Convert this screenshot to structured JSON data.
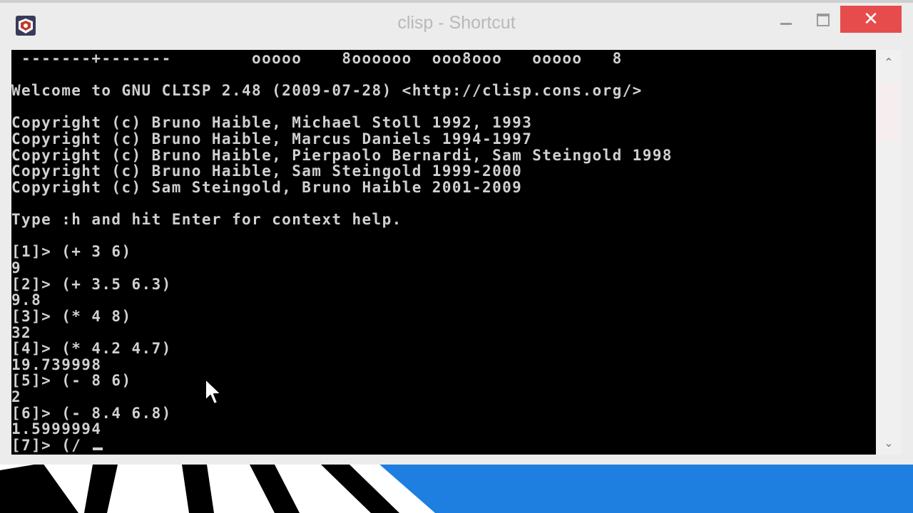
{
  "window": {
    "title": "clisp - Shortcut",
    "close_glyph": "✕"
  },
  "console": {
    "lines": [
      " -------+-------        ooooo    8oooooo  ooo8ooo   ooooo   8",
      "",
      "Welcome to GNU CLISP 2.48 (2009-07-28) <http://clisp.cons.org/>",
      "",
      "Copyright (c) Bruno Haible, Michael Stoll 1992, 1993",
      "Copyright (c) Bruno Haible, Marcus Daniels 1994-1997",
      "Copyright (c) Bruno Haible, Pierpaolo Bernardi, Sam Steingold 1998",
      "Copyright (c) Bruno Haible, Sam Steingold 1999-2000",
      "Copyright (c) Sam Steingold, Bruno Haible 2001-2009",
      "",
      "Type :h and hit Enter for context help.",
      "",
      "[1]> (+ 3 6)",
      "9",
      "[2]> (+ 3.5 6.3)",
      "9.8",
      "[3]> (* 4 8)",
      "32",
      "[4]> (* 4.2 4.7)",
      "19.739998",
      "[5]> (- 8 6)",
      "2",
      "[6]> (- 8.4 6.8)",
      "1.5999994"
    ],
    "current_input": "[7]> (/ "
  },
  "scrollbar": {
    "up_glyph": "⌃",
    "down_glyph": "⌄"
  },
  "colors": {
    "console_bg": "#000000",
    "console_text": "#d0d0d0",
    "close_button": "#e74c4c",
    "wallpaper_blue": "#1e7fe0"
  }
}
